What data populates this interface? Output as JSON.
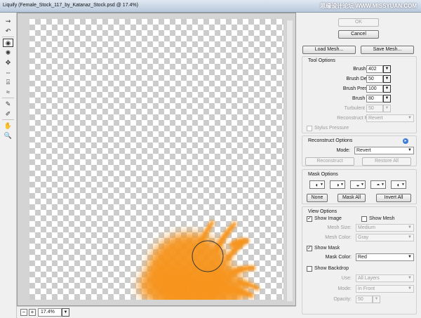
{
  "window": {
    "title": "Liquify (Female_Stock_117_by_Katanaz_Stock.psd @ 17.4%)",
    "watermark": "思缘设计论坛 WWW.MISSYUAN.COM"
  },
  "tools": [
    {
      "icon": "forward-warp-icon",
      "glyph": "⇝"
    },
    {
      "icon": "reconstruct-tool-icon",
      "glyph": "↶"
    },
    {
      "icon": "twirl-clockwise-icon",
      "glyph": "◉"
    },
    {
      "icon": "pucker-tool-icon",
      "glyph": "✺"
    },
    {
      "icon": "bloat-tool-icon",
      "glyph": "✥"
    },
    {
      "icon": "push-left-icon",
      "glyph": "⇔"
    },
    {
      "icon": "mirror-tool-icon",
      "glyph": "⍓"
    },
    {
      "icon": "turbulence-tool-icon",
      "glyph": "≈"
    },
    {
      "icon": "freeze-mask-icon",
      "glyph": "✎"
    },
    {
      "icon": "thaw-mask-icon",
      "glyph": "✐"
    },
    {
      "icon": "hand-tool-icon",
      "glyph": "✋"
    },
    {
      "icon": "zoom-tool-icon",
      "glyph": "🔍"
    }
  ],
  "status": {
    "zoom_out": "−",
    "zoom_in": "+",
    "zoom": "17.4%",
    "dropdown": "▼"
  },
  "buttons": {
    "ok": "OK",
    "cancel": "Cancel",
    "load_mesh": "Load Mesh...",
    "save_mesh": "Save Mesh..."
  },
  "tool_options": {
    "title": "Tool Options",
    "brush_size": {
      "label": "Brush Size:",
      "value": "402"
    },
    "brush_density": {
      "label": "Brush Density:",
      "value": "50"
    },
    "brush_pressure": {
      "label": "Brush Pressure:",
      "value": "100"
    },
    "brush_rate": {
      "label": "Brush Rate:",
      "value": "80"
    },
    "turbulent_jitter": {
      "label": "Turbulent Jitter:",
      "value": "50"
    },
    "reconstruct_mode": {
      "label": "Reconstruct Mode:",
      "value": "Revert"
    },
    "stylus_pressure": {
      "label": "Stylus Pressure",
      "checked": false
    }
  },
  "reconstruct_options": {
    "title": "Reconstruct Options",
    "mode_label": "Mode:",
    "mode_value": "Revert",
    "reconstruct_btn": "Reconstruct",
    "restore_all_btn": "Restore All"
  },
  "mask_options": {
    "title": "Mask Options",
    "none_btn": "None",
    "mask_all_btn": "Mask All",
    "invert_all_btn": "Invert All"
  },
  "view_options": {
    "title": "View Options",
    "show_image": {
      "label": "Show Image",
      "checked": true
    },
    "show_mesh": {
      "label": "Show Mesh",
      "checked": false
    },
    "mesh_size": {
      "label": "Mesh Size:",
      "value": "Medium"
    },
    "mesh_color": {
      "label": "Mesh Color:",
      "value": "Gray"
    },
    "show_mask": {
      "label": "Show Mask",
      "checked": true
    },
    "mask_color": {
      "label": "Mask Color:",
      "value": "Red"
    },
    "show_backdrop": {
      "label": "Show Backdrop",
      "checked": false
    },
    "use": {
      "label": "Use:",
      "value": "All Layers"
    },
    "mode": {
      "label": "Mode:",
      "value": "In Front"
    },
    "opacity": {
      "label": "Opacity:",
      "value": "50"
    }
  },
  "glyphs": {
    "dropdown": "▼",
    "check": "✓",
    "info": "▸"
  },
  "colors": {
    "mask_orange": "#f7941d",
    "titlebar": "#c8d6e6"
  }
}
